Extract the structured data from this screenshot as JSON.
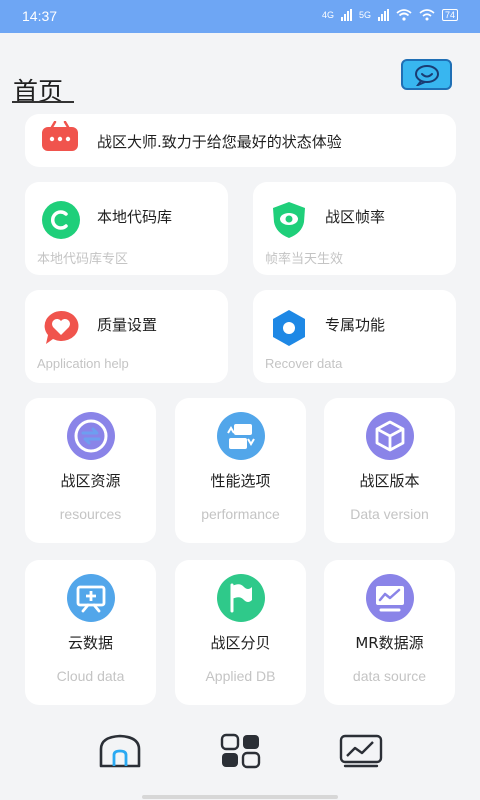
{
  "status_bar": {
    "time": "14:37",
    "net1": "4G",
    "net2": "5G",
    "battery": "74"
  },
  "header": {
    "title": "首页",
    "chat_icon": "chat-bubble-icon"
  },
  "banner": {
    "icon": "message-dots-icon",
    "text": "战区大师.致力于给您最好的状态体验"
  },
  "mid_cards": [
    {
      "icon": "c-circle-icon",
      "title": "本地代码库",
      "subtitle": "本地代码库专区",
      "color": "#1fcf7a"
    },
    {
      "icon": "shield-eye-icon",
      "title": "战区帧率",
      "subtitle": "帧率当天生效",
      "color": "#1fcf7a"
    },
    {
      "icon": "heart-bubble-icon",
      "title": "质量设置",
      "subtitle": "Application help",
      "color": "#f0544d"
    },
    {
      "icon": "hexagon-icon",
      "title": "专属功能",
      "subtitle": "Recover data",
      "color": "#1e88e5"
    }
  ],
  "grid_cards": [
    {
      "icon": "sync-arrows-icon",
      "title": "战区资源",
      "subtitle": "resources",
      "color": "#8a84e8"
    },
    {
      "icon": "swap-cards-icon",
      "title": "性能选项",
      "subtitle": "performance",
      "color": "#52a6ea"
    },
    {
      "icon": "cube-icon",
      "title": "战区版本",
      "subtitle": "Data version",
      "color": "#8a84e8"
    },
    {
      "icon": "cloud-board-icon",
      "title": "云数据",
      "subtitle": "Cloud data",
      "color": "#52a6ea"
    },
    {
      "icon": "flag-icon",
      "title": "战区分贝",
      "subtitle": "Applied DB",
      "color": "#2fc98a"
    },
    {
      "icon": "monitor-chart-icon",
      "title": "MR数据源",
      "subtitle": "data source",
      "color": "#8a84e8"
    }
  ],
  "bottom_nav": [
    {
      "icon": "home-icon",
      "active": true
    },
    {
      "icon": "grid-apps-icon",
      "active": false
    },
    {
      "icon": "trend-chart-icon",
      "active": false
    }
  ]
}
